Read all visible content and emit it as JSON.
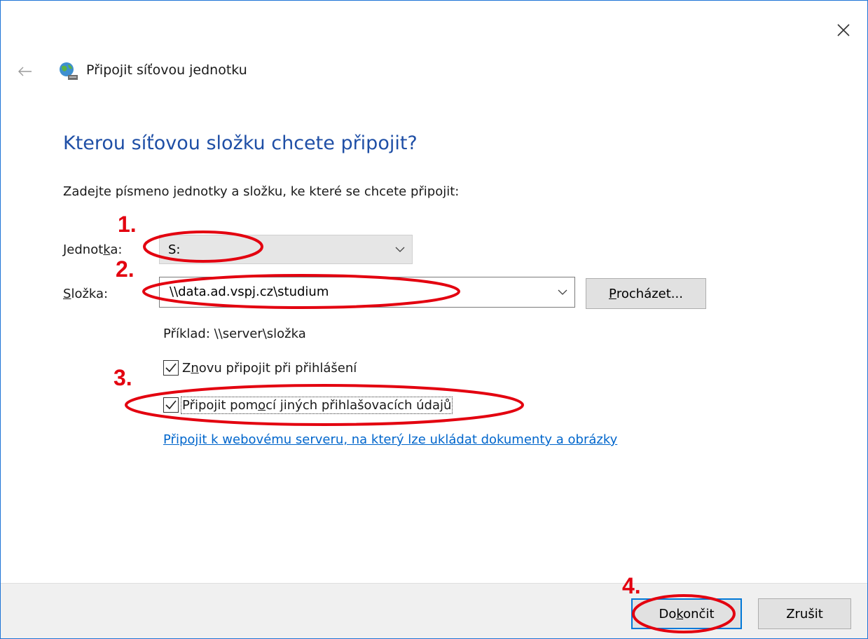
{
  "window": {
    "title": "Připojit síťovou jednotku",
    "close_glyph": "✕"
  },
  "content": {
    "heading": "Kterou síťovou složku chcete připojit?",
    "instruction": "Zadejte písmeno jednotky a složku, ke které se chcete připojit:",
    "drive": {
      "label_pre": "Jednot",
      "label_key": "k",
      "label_post": "a:",
      "value": "S:"
    },
    "folder": {
      "label_key": "S",
      "label_post": "ložka:",
      "value": "\\\\data.ad.vspj.cz\\studium"
    },
    "browse": {
      "key": "P",
      "post": "rocházet..."
    },
    "example": "Příklad: \\\\server\\složka",
    "reconnect": {
      "checked": true,
      "pre": "Z",
      "key": "n",
      "post": "ovu připojit při přihlášení"
    },
    "other_credentials": {
      "checked": true,
      "pre": "Připojit pom",
      "key": "o",
      "post": "cí jiných přihlašovacích údajů"
    },
    "link": "Připojit k webovému serveru, na který lze ukládat dokumenty a obrázky"
  },
  "footer": {
    "finish": {
      "pre": "Do",
      "key": "k",
      "post": "ončit"
    },
    "cancel": "Zrušit"
  },
  "annotations": [
    "1.",
    "2.",
    "3.",
    "4."
  ],
  "colors": {
    "accent": "#0078d7",
    "heading": "#1f4fa6",
    "link": "#0066cc",
    "annotation": "#e3000f"
  }
}
